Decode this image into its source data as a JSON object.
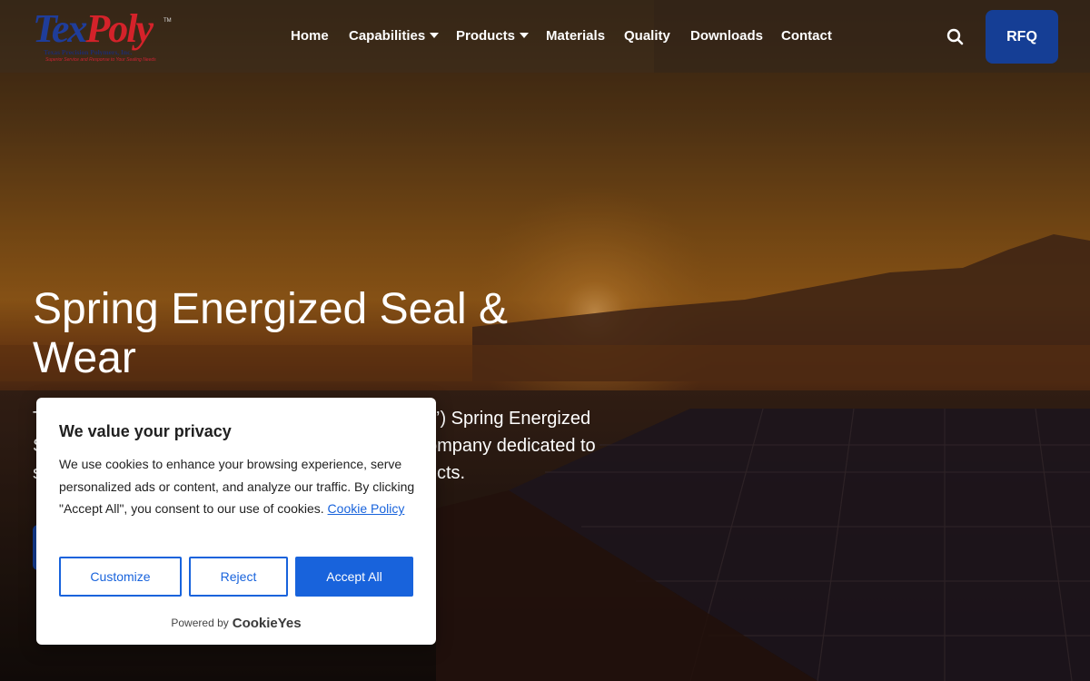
{
  "brand": {
    "logo_main_part1": "Tex",
    "logo_main_part2": "Poly",
    "logo_tm": "TM",
    "logo_company": "Texas Precision Polymers, Inc.",
    "logo_tagline": "Superior Service and Response to Your Sealing Needs",
    "colors": {
      "blue": "#1f3d9a",
      "red": "#d4222a"
    }
  },
  "nav": {
    "items": [
      {
        "label": "Home",
        "has_dropdown": false
      },
      {
        "label": "Capabilities",
        "has_dropdown": true
      },
      {
        "label": "Products",
        "has_dropdown": true
      },
      {
        "label": "Materials",
        "has_dropdown": false
      },
      {
        "label": "Quality",
        "has_dropdown": false
      },
      {
        "label": "Downloads",
        "has_dropdown": false
      },
      {
        "label": "Contact",
        "has_dropdown": false
      }
    ],
    "search_icon": "search-icon",
    "rfq_label": "RFQ",
    "accent": "#153e95"
  },
  "hero": {
    "title": "Spring Energized Seal & Wear",
    "text_visible_parts": [
      "T",
      "’) Spring Energized",
      "S",
      "ompany dedicated to",
      "s",
      "cts."
    ]
  },
  "cookie_banner": {
    "title": "We value your privacy",
    "body": "We use cookies to enhance your browsing experience, serve personalized ads or content, and analyze our traffic. By clicking \"Accept All\", you consent to our use of cookies.",
    "policy_link": "Cookie Policy",
    "customize_label": "Customize",
    "reject_label": "Reject",
    "accept_label": "Accept All",
    "powered_by": "Powered by",
    "powered_brand": "CookieYes",
    "accent": "#1863dc"
  }
}
